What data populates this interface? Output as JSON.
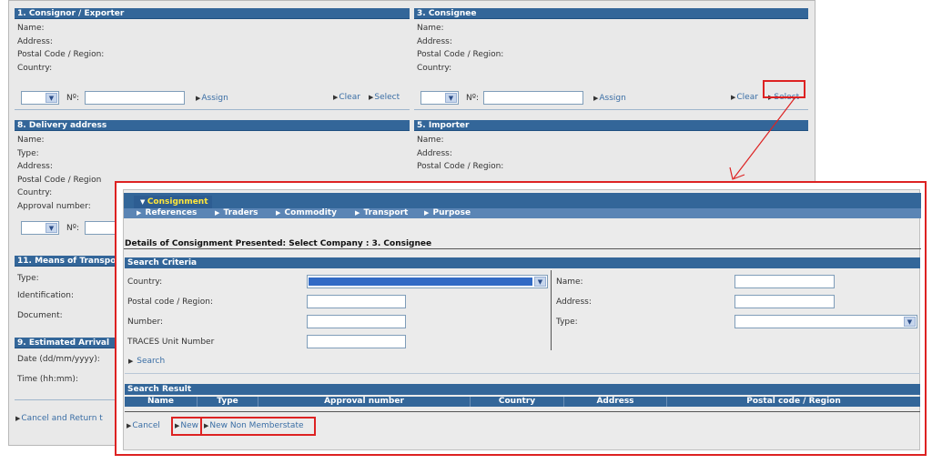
{
  "consignor": {
    "title": "1. Consignor / Exporter",
    "fields": [
      "Name:",
      "Address:",
      "Postal Code / Region:",
      "Country:"
    ],
    "no_label": "Nº:",
    "assign": "Assign",
    "clear": "Clear",
    "select": "Select"
  },
  "consignee": {
    "title": "3. Consignee",
    "fields": [
      "Name:",
      "Address:",
      "Postal Code / Region:",
      "Country:"
    ],
    "no_label": "Nº:",
    "assign": "Assign",
    "clear": "Clear",
    "select": "Select"
  },
  "delivery": {
    "title": "8. Delivery address",
    "fields": [
      "Name:",
      "Type:",
      "Address:",
      "Postal Code / Region",
      "Country:",
      "Approval number:"
    ],
    "no_label": "Nº:"
  },
  "importer": {
    "title": "5. Importer",
    "fields": [
      "Name:",
      "Address:",
      "Postal Code / Region:"
    ]
  },
  "transport": {
    "title": "11. Means of Transpo",
    "fields": [
      "Type:",
      "Identification:",
      "Document:"
    ]
  },
  "arrival": {
    "title": "9. Estimated Arrival",
    "fields": [
      "Date (dd/mm/yyyy):",
      "Time (hh:mm):"
    ]
  },
  "footer": {
    "cancel_return": "Cancel and Return t"
  },
  "dialog": {
    "nav_active": "Consignment",
    "nav_items": [
      "References",
      "Traders",
      "Commodity",
      "Transport",
      "Purpose"
    ],
    "title": "Details of Consignment Presented: Select Company : 3. Consignee",
    "criteria_title": "Search Criteria",
    "country_label": "Country:",
    "postal_label": "Postal code / Region:",
    "number_label": "Number:",
    "traces_label": "TRACES Unit Number",
    "name_label": "Name:",
    "address_label": "Address:",
    "type_label": "Type:",
    "search": "Search",
    "result_title": "Search Result",
    "columns": [
      "Name",
      "Type",
      "Approval number",
      "Country",
      "Address",
      "Postal code / Region"
    ],
    "cancel": "Cancel",
    "new": "New",
    "new_non_member": "New Non Memberstate"
  },
  "colors": {
    "header_blue": "#336699",
    "highlight_red": "#dd2222",
    "active_tab_text": "#ffe63b",
    "link_blue": "#3a6ea5"
  }
}
